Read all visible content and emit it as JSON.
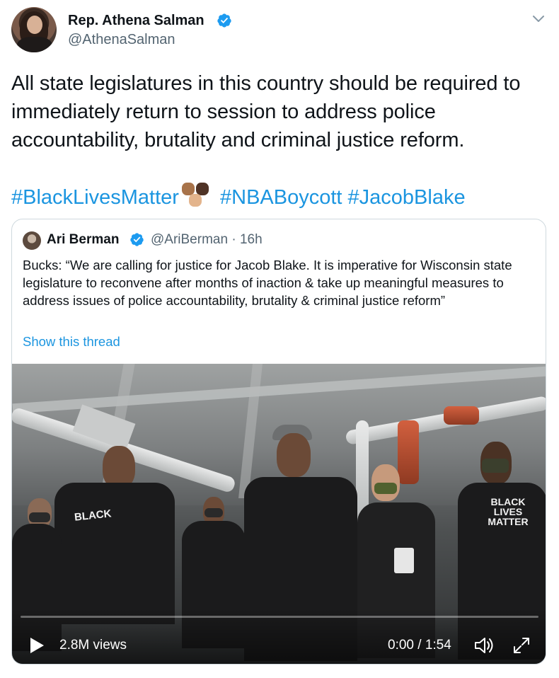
{
  "tweet": {
    "author_name": "Rep. Athena Salman",
    "author_handle": "@AthenaSalman",
    "text": "All state legislatures in this country should be required to immediately return to session to address police accountability, brutality and criminal justice reform.",
    "hashtags": [
      "#BlackLivesMatter",
      "#NBABoycott",
      "#JacobBlake"
    ]
  },
  "quote": {
    "author_name": "Ari Berman",
    "author_handle": "@AriBerman",
    "separator": "·",
    "time_ago": "16h",
    "text": "Bucks: “We are calling for justice for Jacob Blake. It is imperative for Wisconsin state legislature to reconvene after months of inaction & take up meaningful measures to address issues of police accountability, brutality & criminal justice reform”",
    "show_thread_label": "Show this thread",
    "video": {
      "views": "2.8M views",
      "current_time": "0:00",
      "duration": "1:54",
      "time_separator": " / ",
      "progress_fraction": 0.0,
      "shirt_texts": [
        "BLACK",
        "BLACK LIVES MATTER"
      ]
    }
  },
  "colors": {
    "link": "#1b95e0",
    "verified": "#1d9bf0",
    "secondary_text": "#536471",
    "border": "#cfd9de"
  },
  "icons": {
    "verified": "verified-badge-icon",
    "more": "chevron-down-icon",
    "play": "play-icon",
    "volume": "volume-icon",
    "fullscreen": "fullscreen-icon"
  }
}
